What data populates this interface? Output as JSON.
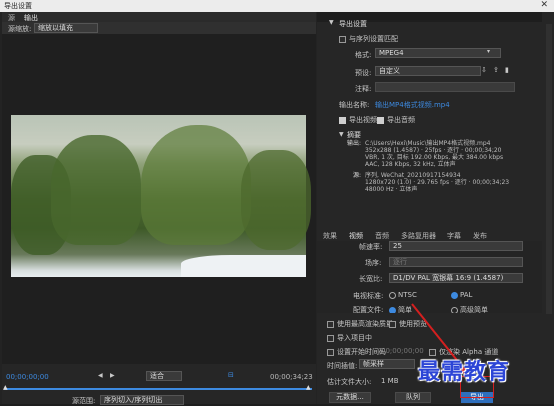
{
  "window": {
    "title": "导出设置",
    "close_glyph": "✕"
  },
  "left_panel": {
    "tabs": [
      {
        "label": "源"
      },
      {
        "label": "输出"
      }
    ],
    "crop_label": "源缩放:",
    "crop_value": "缩放以填充",
    "timecode_start": "00;00;00;00",
    "timecode_end": "00;00;34;23",
    "fit_value": "适合",
    "source_range_label": "源范围:",
    "source_range_value": "序列切入/序列切出"
  },
  "export_settings": {
    "section_title": "导出设置",
    "match_sequence_label": "与序列设置匹配",
    "format_label": "格式:",
    "format_value": "MPEG4",
    "preset_label": "预设:",
    "preset_value": "自定义",
    "comment_label": "注释:",
    "output_name_label": "输出名称:",
    "output_name_value": "输出MP4格式视频.mp4",
    "export_video_label": "导出视频",
    "export_audio_label": "导出音频",
    "summary_title": "摘要",
    "summary_output_label": "输出:",
    "summary_output_lines": [
      "C:\\Users\\Hexi\\Music\\输出MP4格式视频.mp4",
      "352x288 (1.4587) · 25fps · 逐行 · 00;00;34;20",
      "VBR, 1 次, 目标 192.00 Kbps, 最大 384.00 kbps",
      "AAC, 128 Kbps, 32 kHz, 立体声"
    ],
    "summary_source_label": "源:",
    "summary_source_lines": [
      "序列, WeChat_20210917154934",
      "1280x720 (1.0) · 29.765 fps · 逐行 · 00;00;34;23",
      "48000 Hz · 立体声"
    ]
  },
  "right_tabs": [
    {
      "label": "效果"
    },
    {
      "label": "视频"
    },
    {
      "label": "音频"
    },
    {
      "label": "多路复用器"
    },
    {
      "label": "字幕"
    },
    {
      "label": "发布"
    }
  ],
  "video_settings": {
    "framerate_label": "帧速率:",
    "framerate_value": "25",
    "field_label": "场序:",
    "field_value": "逐行",
    "aspect_label": "长宽比:",
    "aspect_value": "D1/DV PAL 宽银幕 16:9 (1.4587)",
    "tv_standard_label": "电视标准:",
    "ntsc_label": "NTSC",
    "pal_label": "PAL",
    "profile_label": "配置文件:",
    "profile_opt1": "简单",
    "profile_opt2": "高级简单"
  },
  "options": {
    "max_render_quality": "使用最高渲染质量",
    "use_preview": "使用预览",
    "import_into_project": "导入项目中",
    "set_start_timecode": "设置开始时间码",
    "timecode_value": "00;00;00;00",
    "render_alpha": "仅渲染 Alpha 通道",
    "time_interpolation_label": "时间插值:",
    "time_interpolation_value": "帧采样",
    "estimated_size_label": "估计文件大小:",
    "estimated_size_value": "1 MB",
    "metadata_button": "元数据...",
    "queue_button": "队列",
    "export_button": "导出"
  },
  "watermark": {
    "text": "最需教育"
  },
  "colors": {
    "accent": "#3d8ae0",
    "highlight": "#d41f1f",
    "watermark": "#2c45d6"
  }
}
